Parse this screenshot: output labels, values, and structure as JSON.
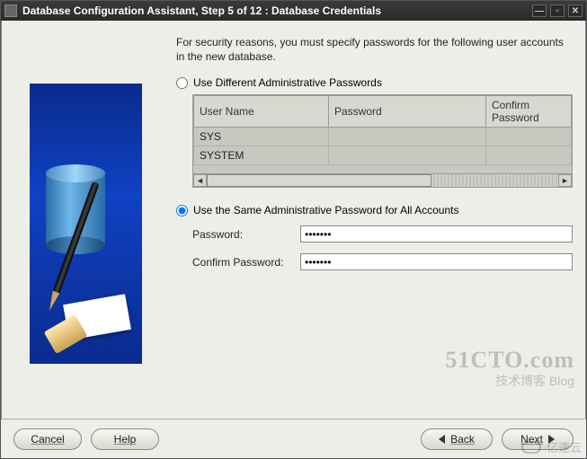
{
  "window": {
    "title": "Database Configuration Assistant, Step 5 of 12 : Database Credentials"
  },
  "intro": "For security reasons, you must specify passwords for the following user accounts in the new database.",
  "option_diff": {
    "label": "Use Different Administrative Passwords",
    "selected": false
  },
  "table": {
    "headers": {
      "user": "User Name",
      "pwd": "Password",
      "cpwd": "Confirm Password"
    },
    "rows": [
      {
        "user": "SYS",
        "pwd": "",
        "cpwd": ""
      },
      {
        "user": "SYSTEM",
        "pwd": "",
        "cpwd": ""
      }
    ]
  },
  "option_same": {
    "label": "Use the Same Administrative Password for All Accounts",
    "selected": true,
    "password_label": "Password:",
    "password_value": "*******",
    "confirm_label": "Confirm Password:",
    "confirm_value": "*******"
  },
  "buttons": {
    "cancel": "Cancel",
    "help": "Help",
    "back": "Back",
    "next": "Next"
  },
  "watermarks": {
    "w1": "51CTO.com",
    "w2": "技术博客  Blog",
    "w3": "亿速云"
  }
}
